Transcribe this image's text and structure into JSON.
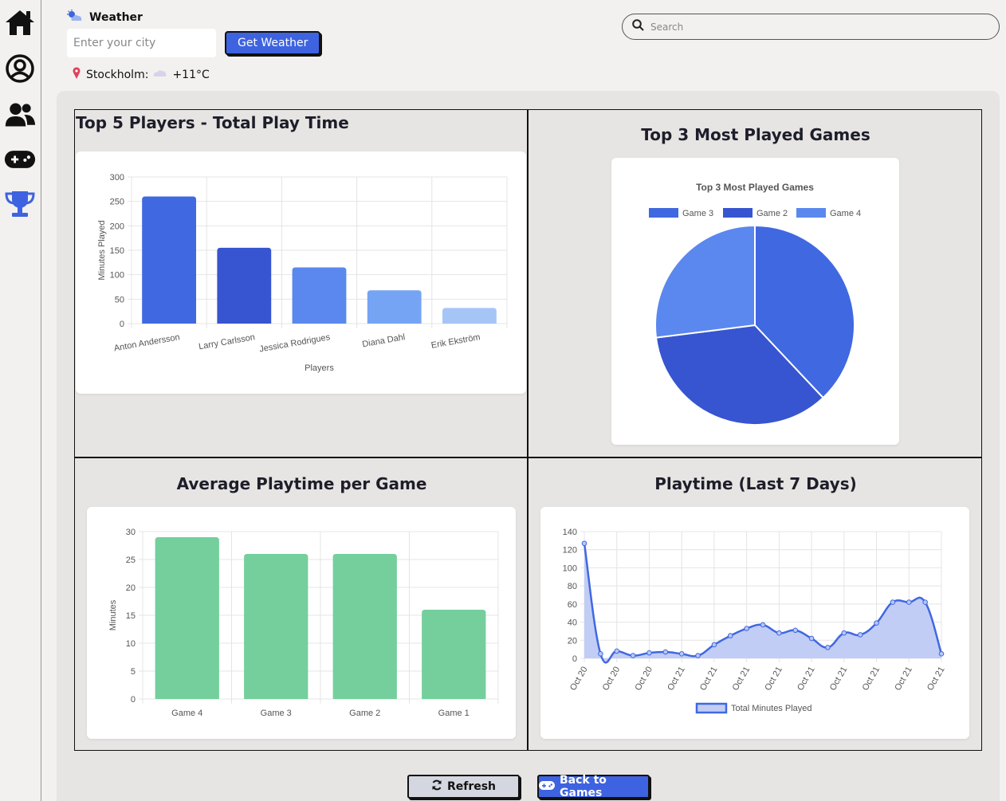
{
  "colors": {
    "accent": "#3e63e0",
    "green": "#74cf9c",
    "blue_dark": "#3755d0",
    "blue": "#4068e1",
    "blue_mid": "#5a88ee",
    "blue_light": "#76a4f5",
    "blue_pale": "#a6c5f7"
  },
  "sidebar": {
    "items": [
      {
        "icon": "home-icon"
      },
      {
        "icon": "profile-icon"
      },
      {
        "icon": "users-icon"
      },
      {
        "icon": "gamepad-icon"
      },
      {
        "icon": "trophy-icon"
      }
    ]
  },
  "weather": {
    "title": "Weather",
    "city_placeholder": "Enter your city",
    "button": "Get Weather",
    "location": "Stockholm:",
    "temperature": "+11°C"
  },
  "search": {
    "placeholder": "Search"
  },
  "cards": {
    "top_players": "Top 5 Players - Total Play Time",
    "top_games": "Top 3 Most Played Games",
    "avg_playtime": "Average Playtime per Game",
    "last7": "Playtime (Last 7 Days)"
  },
  "buttons": {
    "refresh": "Refresh",
    "back": "Back to Games"
  },
  "chart_data": [
    {
      "type": "bar",
      "categories": [
        "Anton Andersson",
        "Larry Carlsson",
        "Jessica Rodrigues",
        "Diana Dahl",
        "Erik Ekström"
      ],
      "values": [
        260,
        155,
        115,
        68,
        32
      ],
      "colors": [
        "#4068e1",
        "#3755d0",
        "#5a88ee",
        "#76a4f5",
        "#a6c5f7"
      ],
      "xlabel": "Players",
      "ylabel": "Minutes Played",
      "ylim": [
        0,
        300
      ],
      "yticks": [
        0,
        50,
        100,
        150,
        200,
        250,
        300
      ],
      "grid": true
    },
    {
      "type": "pie",
      "title": "Top 3 Most Played Games",
      "labels": [
        "Game 3",
        "Game 2",
        "Game 4"
      ],
      "values": [
        38,
        35,
        27
      ],
      "colors": [
        "#4068e1",
        "#3755d0",
        "#5a88ee"
      ],
      "legend": "top"
    },
    {
      "type": "bar",
      "categories": [
        "Game 4",
        "Game 3",
        "Game 2",
        "Game 1"
      ],
      "values": [
        29,
        26,
        26,
        16
      ],
      "ylabel": "Minutes",
      "ylim": [
        0,
        30
      ],
      "yticks": [
        0,
        5,
        10,
        15,
        20,
        25,
        30
      ],
      "grid": true
    },
    {
      "type": "area",
      "series": [
        {
          "name": "Total Minutes Played",
          "values": [
            127,
            5,
            8,
            3,
            6,
            7,
            5,
            3,
            15,
            25,
            33,
            37,
            28,
            31,
            22,
            12,
            28,
            26,
            39,
            62,
            62,
            62,
            5
          ]
        }
      ],
      "xticks": [
        "Oct 20",
        "Oct 20",
        "Oct 20",
        "Oct 21",
        "Oct 21",
        "Oct 21",
        "Oct 21",
        "Oct 21",
        "Oct 21",
        "Oct 21",
        "Oct 21",
        "Oct 21"
      ],
      "ylim": [
        0,
        140
      ],
      "yticks": [
        0,
        20,
        40,
        60,
        80,
        100,
        120,
        140
      ],
      "legend": "bottom",
      "grid": true
    }
  ]
}
